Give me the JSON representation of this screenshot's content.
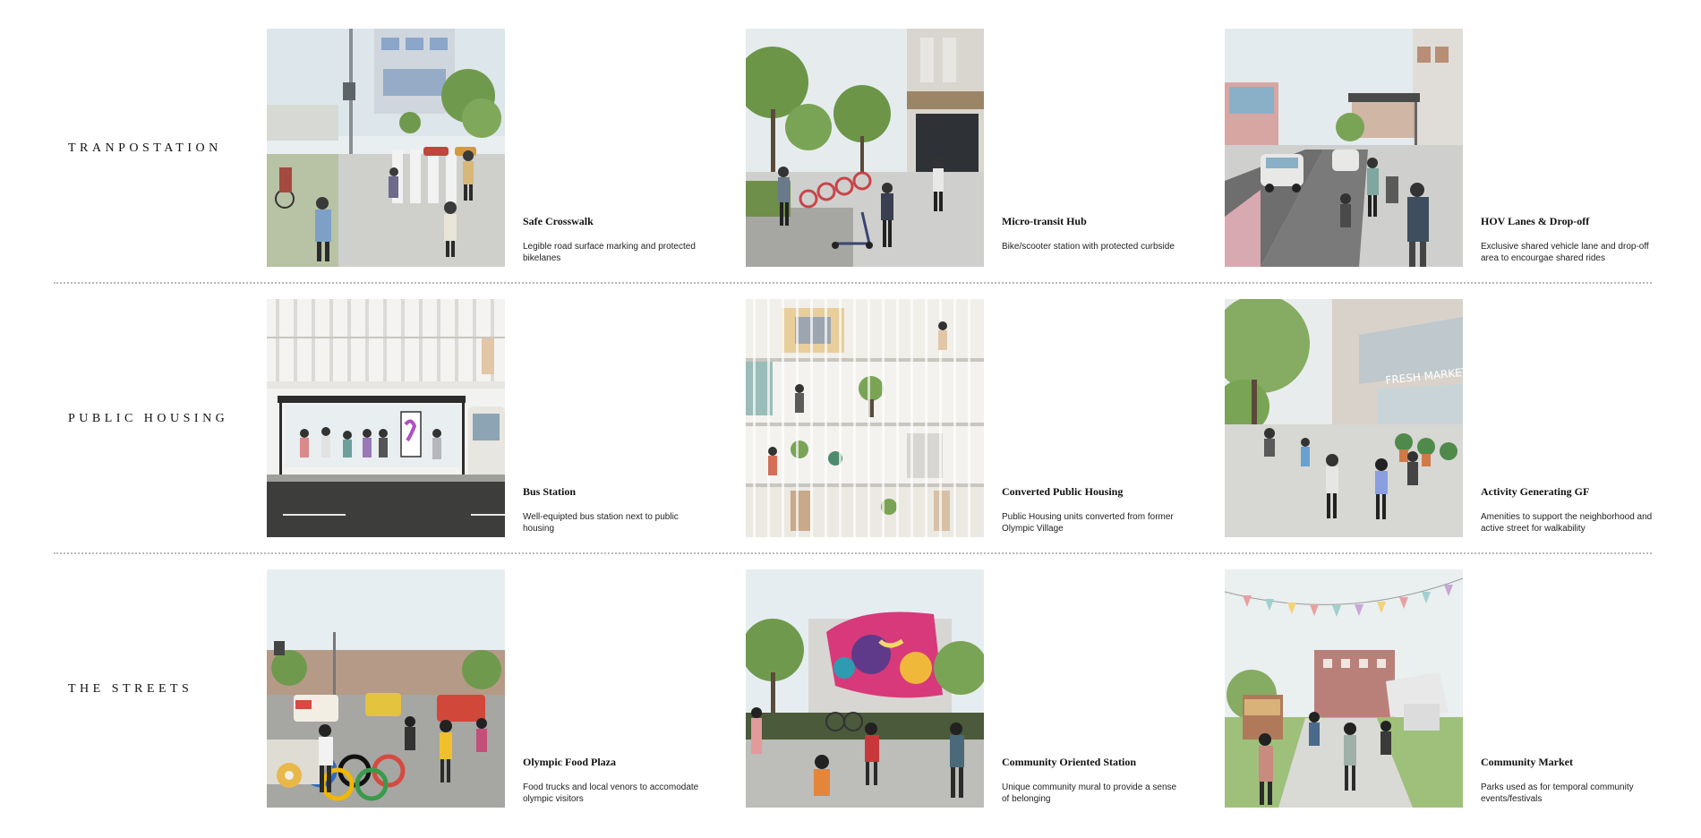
{
  "rows": [
    {
      "label": "TRANPOSTATION",
      "cards": [
        {
          "title": "Safe Crosswalk",
          "desc": "Legible road surface marking and protected bikelanes"
        },
        {
          "title": "Micro-transit Hub",
          "desc": "Bike/scooter station with protected curbside"
        },
        {
          "title": "HOV Lanes & Drop-off",
          "desc": "Exclusive shared vehicle lane and drop-off area to encourgae shared rides"
        }
      ]
    },
    {
      "label": "PUBLIC HOUSING",
      "cards": [
        {
          "title": "Bus Station",
          "desc": "Well-equipted bus station next to public housing"
        },
        {
          "title": "Converted Public Housing",
          "desc": "Public Housing units converted from former Olympic Village"
        },
        {
          "title": "Activity Generating GF",
          "desc": "Amenities to support the neighborhood and active street for walkability"
        }
      ]
    },
    {
      "label": "THE STREETS",
      "cards": [
        {
          "title": "Olympic Food Plaza",
          "desc": "Food trucks and local venors to accomodate olympic visitors"
        },
        {
          "title": "Community Oriented Station",
          "desc": "Unique community mural to provide a sense of belonging"
        },
        {
          "title": "Community Market",
          "desc": "Parks used as for temporal community events/festivals"
        }
      ]
    }
  ],
  "image_lettering": {
    "market_sign": "FRESH MARKET"
  }
}
